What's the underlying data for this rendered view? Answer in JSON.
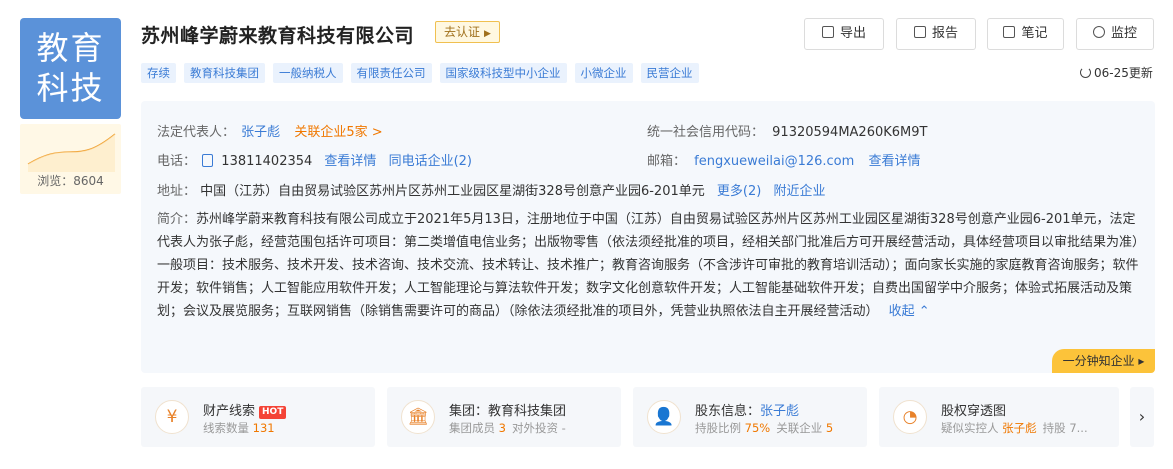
{
  "logo": {
    "line1": "教育",
    "line2": "科技"
  },
  "views": "浏览：8604",
  "company": {
    "name": "苏州峰学蔚来教育科技有限公司",
    "claim_label": "去认证"
  },
  "tags": [
    "存续",
    "教育科技集团",
    "一般纳税人",
    "有限责任公司",
    "国家级科技型中小企业",
    "小微企业",
    "民营企业"
  ],
  "toolbar": {
    "export": "导出",
    "report": "报告",
    "notes": "笔记",
    "monitor": "监控"
  },
  "update": "06-25更新",
  "info": {
    "legal_rep_label": "法定代表人：",
    "legal_rep": "张子彪",
    "related": "关联企业5家 >",
    "credit_label": "统一社会信用代码：",
    "credit_code": "91320594MA260K6M9T",
    "phone_label": "电话：",
    "phone": "13811402354",
    "view_detail": "查看详情",
    "same_phone": "同电话企业(2)",
    "email_label": "邮箱：",
    "email": "fengxueweilai@126.com",
    "email_detail": "查看详情",
    "addr_label": "地址：",
    "address": "中国（江苏）自由贸易试验区苏州片区苏州工业园区星湖街328号创意产业园6-201单元",
    "more": "更多(2)",
    "nearby": "附近企业",
    "intro_label": "简介：",
    "intro": "苏州峰学蔚来教育科技有限公司成立于2021年5月13日，注册地位于中国（江苏）自由贸易试验区苏州片区苏州工业园区星湖街328号创意产业园6-201单元，法定代表人为张子彪，经营范围包括许可项目：第二类增值电信业务；出版物零售（依法须经批准的项目，经相关部门批准后方可开展经营活动，具体经营项目以审批结果为准）一般项目：技术服务、技术开发、技术咨询、技术交流、技术转让、技术推广；教育咨询服务（不含涉许可审批的教育培训活动）；面向家长实施的家庭教育咨询服务；软件开发；软件销售；人工智能应用软件开发；人工智能理论与算法软件开发；数字文化创意软件开发；人工智能基础软件开发；自费出国留学中介服务；体验式拓展活动及策划；会议及展览服务；互联网销售（除销售需要许可的商品）（除依法须经批准的项目外，凭营业执照依法自主开展经营活动）",
    "collapse": "收起 ⌃",
    "quick": "一分钟知企业 ▸"
  },
  "cards": [
    {
      "title": "财产线索",
      "hot": "HOT",
      "sub1": "线索数量 ",
      "sub1v": "131",
      "sub2": "",
      "sub2v": ""
    },
    {
      "title": "集团：教育科技集团",
      "sub1": "集团成员 ",
      "sub1v": "3",
      "sub2": "对外投资 ",
      "sub2v": "-"
    },
    {
      "title_pre": "股东信息：",
      "title_link": "张子彪",
      "sub1": "持股比例 ",
      "sub1v": "75%",
      "sub2": "关联企业 ",
      "sub2v": "5"
    },
    {
      "title": "股权穿透图",
      "sub1": "疑似实控人 ",
      "sub1v": "张子彪",
      "sub2": "持股 ",
      "sub2v": "7..."
    }
  ],
  "colors": {
    "brand_blue": "#3a7bd5",
    "orange": "#f07800",
    "logo_bg": "#5b92d9",
    "yellow": "#fcc33a"
  }
}
